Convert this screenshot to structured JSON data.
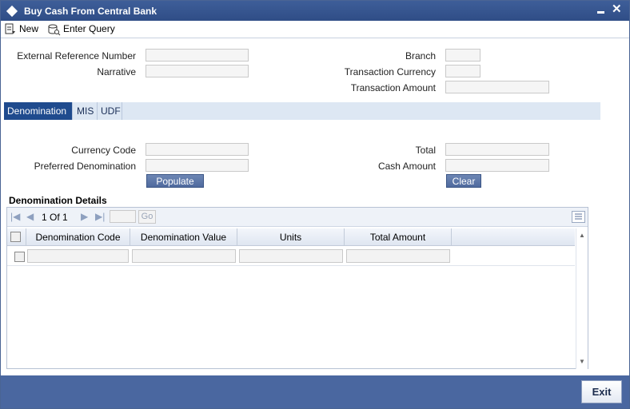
{
  "window": {
    "title": "Buy Cash From Central Bank"
  },
  "toolbar": {
    "new_label": "New",
    "enter_query_label": "Enter Query"
  },
  "header_fields": {
    "external_reference_number": {
      "label": "External Reference Number",
      "value": ""
    },
    "narrative": {
      "label": "Narrative",
      "value": ""
    },
    "branch": {
      "label": "Branch",
      "value": ""
    },
    "transaction_currency": {
      "label": "Transaction Currency",
      "value": ""
    },
    "transaction_amount": {
      "label": "Transaction Amount",
      "value": ""
    }
  },
  "tabs": [
    {
      "label": "Denomination",
      "active": true
    },
    {
      "label": "MIS",
      "active": false
    },
    {
      "label": "UDF",
      "active": false
    }
  ],
  "denomination": {
    "currency_code": {
      "label": "Currency Code",
      "value": ""
    },
    "preferred_denomination": {
      "label": "Preferred Denomination",
      "value": ""
    },
    "total": {
      "label": "Total",
      "value": ""
    },
    "cash_amount": {
      "label": "Cash Amount",
      "value": ""
    },
    "populate_label": "Populate",
    "clear_label": "Clear"
  },
  "details": {
    "title": "Denomination Details",
    "pager": {
      "text": "1 Of 1",
      "go_label": "Go"
    },
    "columns": [
      "Denomination Code",
      "Denomination Value",
      "Units",
      "Total Amount"
    ],
    "rows": [
      {
        "denomination_code": "",
        "denomination_value": "",
        "units": "",
        "total_amount": ""
      }
    ]
  },
  "footer": {
    "exit_label": "Exit"
  },
  "colors": {
    "title_bar": "#2f4d86",
    "active_tab": "#1f4b8e",
    "footer": "#4a67a0"
  }
}
